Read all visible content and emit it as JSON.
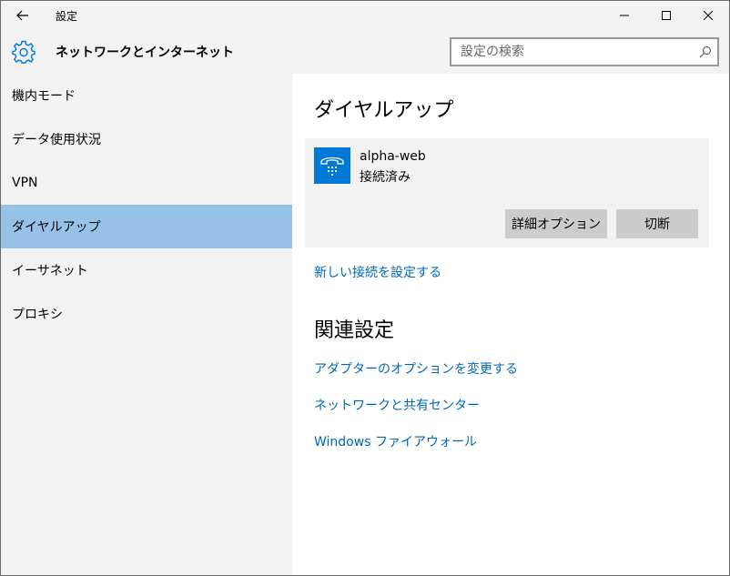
{
  "titlebar": {
    "title": "設定",
    "back_icon": "back-arrow-icon",
    "minimize_icon": "minimize-icon",
    "maximize_icon": "maximize-icon",
    "close_icon": "close-icon"
  },
  "header": {
    "icon": "gear-icon",
    "title": "ネットワークとインターネット",
    "search": {
      "placeholder": "設定の検索",
      "value": "",
      "icon": "search-icon"
    }
  },
  "sidebar": {
    "items": [
      {
        "label": "機内モード",
        "selected": false
      },
      {
        "label": "データ使用状況",
        "selected": false
      },
      {
        "label": "VPN",
        "selected": false
      },
      {
        "label": "ダイヤルアップ",
        "selected": true
      },
      {
        "label": "イーサネット",
        "selected": false
      },
      {
        "label": "プロキシ",
        "selected": false
      }
    ]
  },
  "main": {
    "title": "ダイヤルアップ",
    "connection": {
      "name": "alpha-web",
      "status": "接続済み",
      "icon": "dialup-phone-icon",
      "advanced_button": "詳細オプション",
      "disconnect_button": "切断"
    },
    "new_connection_link": "新しい接続を設定する",
    "related_title": "関連設定",
    "related_links": [
      "アダプターのオプションを変更する",
      "ネットワークと共有センター",
      "Windows ファイアウォール"
    ]
  },
  "colors": {
    "accent": "#0078d7",
    "link": "#0067b8",
    "selected_bg": "#97c2e8",
    "button_bg": "#cccccc",
    "sidebar_bg": "#f2f2f2"
  }
}
